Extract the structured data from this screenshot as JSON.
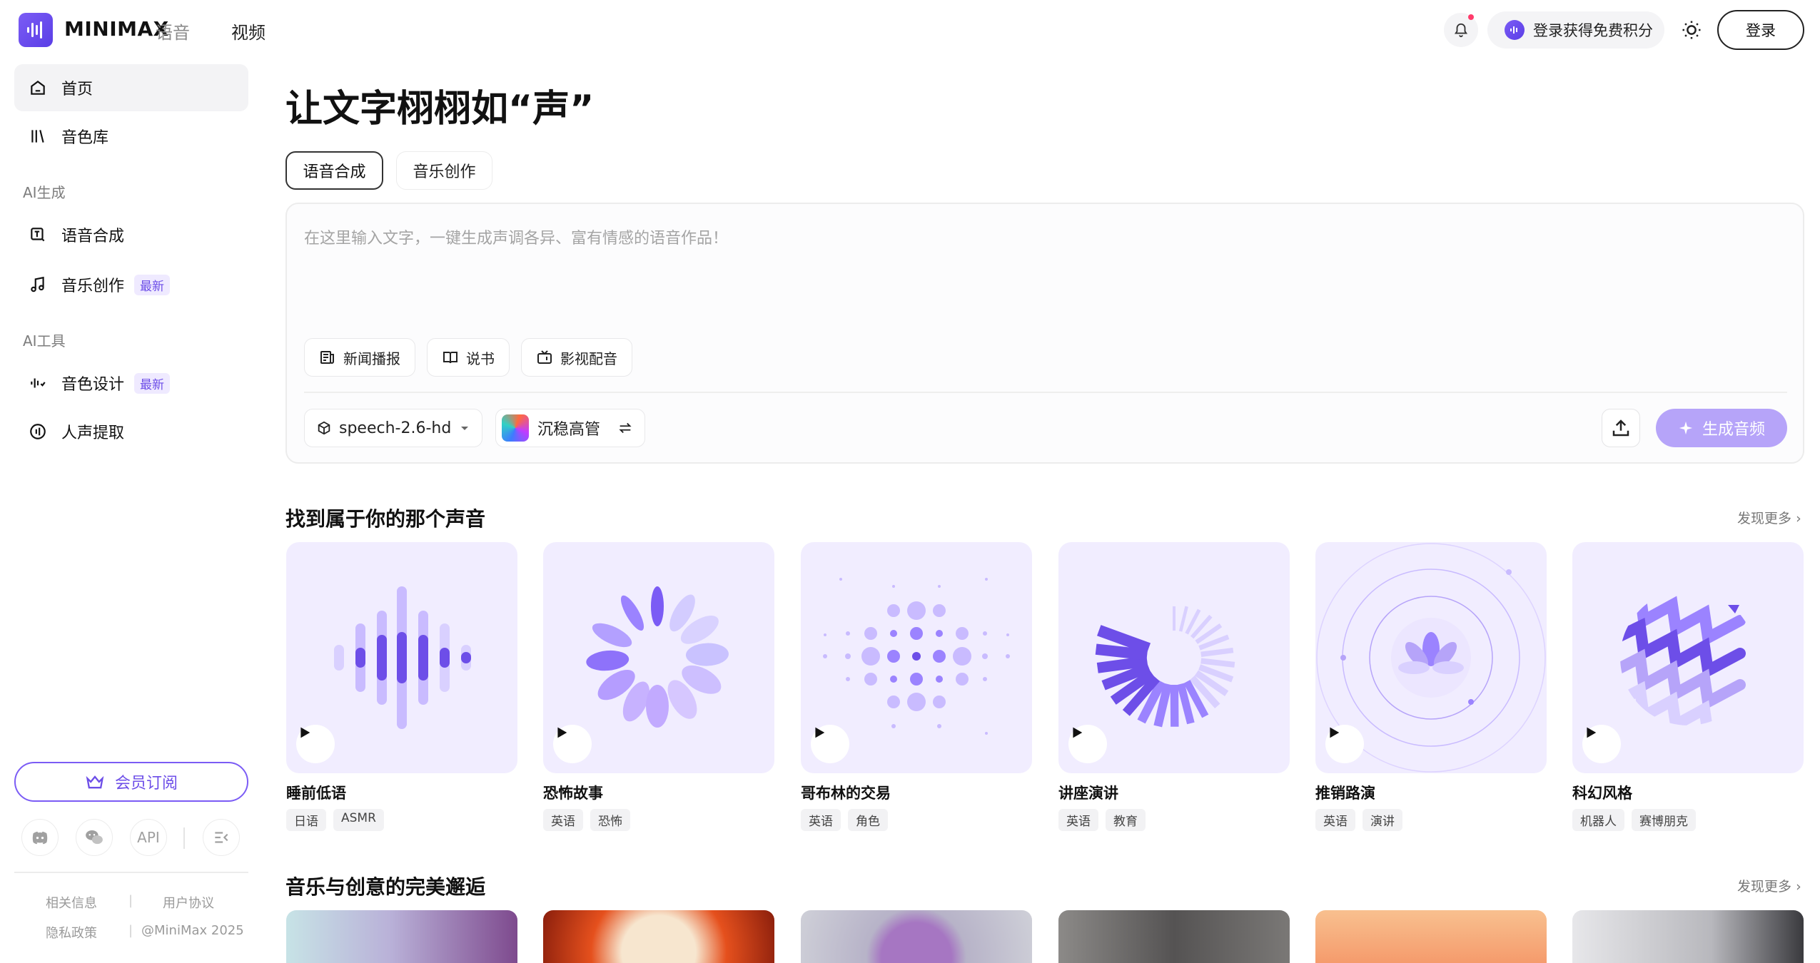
{
  "header": {
    "brand": "MINIMAX",
    "brand_sub": "语音",
    "nav_video": "视频",
    "promo_label": "登录获得免费积分",
    "login_label": "登录"
  },
  "sidebar": {
    "items_top": [
      {
        "label": "首页",
        "icon": "home-icon",
        "active": true
      },
      {
        "label": "音色库",
        "icon": "library-icon"
      }
    ],
    "section_ai_gen": "AI生成",
    "items_gen": [
      {
        "label": "语音合成",
        "icon": "speech-synthesis-icon"
      },
      {
        "label": "音乐创作",
        "icon": "music-note-icon",
        "badge": "最新"
      }
    ],
    "section_ai_tools": "AI工具",
    "items_tools": [
      {
        "label": "音色设计",
        "icon": "voice-design-icon",
        "badge": "最新"
      },
      {
        "label": "人声提取",
        "icon": "vocal-extract-icon"
      }
    ],
    "vip_label": "会员订阅",
    "social": [
      {
        "icon": "discord-icon"
      },
      {
        "icon": "wechat-icon"
      },
      {
        "label": "API"
      },
      {
        "icon": "collapse-sidebar-icon"
      }
    ],
    "footer": {
      "related": "相关信息",
      "terms": "用户协议",
      "privacy": "隐私政策",
      "copyright": "@MiniMax 2025"
    }
  },
  "main": {
    "hero_title": "让文字栩栩如“声”",
    "tabs": [
      {
        "label": "语音合成",
        "selected": true
      },
      {
        "label": "音乐创作",
        "selected": false
      }
    ],
    "editor": {
      "placeholder": "在这里输入文字，一键生成声调各异、富有情感的语音作品！",
      "chips": [
        {
          "label": "新闻播报",
          "icon": "news-icon"
        },
        {
          "label": "说书",
          "icon": "book-icon"
        },
        {
          "label": "影视配音",
          "icon": "tv-icon"
        }
      ],
      "model": "speech-2.6-hd",
      "voice": "沉稳高管",
      "generate_label": "生成音频"
    },
    "section1": {
      "title": "找到属于你的那个声音",
      "more": "发现更多",
      "cards": [
        {
          "title": "睡前低语",
          "tags": [
            "日语",
            "ASMR"
          ]
        },
        {
          "title": "恐怖故事",
          "tags": [
            "英语",
            "恐怖"
          ]
        },
        {
          "title": "哥布林的交易",
          "tags": [
            "英语",
            "角色"
          ]
        },
        {
          "title": "讲座演讲",
          "tags": [
            "英语",
            "教育"
          ]
        },
        {
          "title": "推销路演",
          "tags": [
            "英语",
            "演讲"
          ]
        },
        {
          "title": "科幻风格",
          "tags": [
            "机器人",
            "赛博朋克"
          ]
        }
      ]
    },
    "section2": {
      "title": "音乐与创意的完美邂逅",
      "more": "发现更多"
    }
  },
  "colors": {
    "accent": "#7b5cf5",
    "accent_light": "#b6a4f9",
    "card_bg": "#f1edff"
  }
}
